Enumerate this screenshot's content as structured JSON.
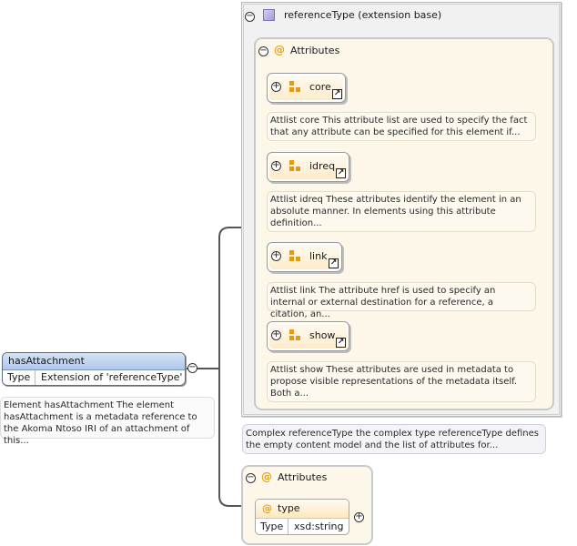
{
  "reference_type": {
    "title": "referenceType (extension base)",
    "attributes_label": "Attributes",
    "attlists": [
      {
        "name": "core",
        "description": "Attlist core This attribute list are used to specify the fact that any attribute can be specified for this element if..."
      },
      {
        "name": "idreq",
        "description": "Attlist idreq These attributes identify the element in an absolute manner. In elements using this attribute definition..."
      },
      {
        "name": "link",
        "description": "Attlist link The attribute href is used to specify an internal or external destination for a reference, a citation, an..."
      },
      {
        "name": "show",
        "description": "Attlist show These attributes are used in metadata to propose visible representations of the metadata itself. Both a..."
      }
    ],
    "description": "Complex referenceType the complex type referenceType defines the empty content model and the list of attributes for..."
  },
  "element": {
    "name": "hasAttachment",
    "type_key": "Type",
    "type_value": "Extension of 'referenceType'",
    "description": "Element hasAttachment The element hasAttachment is a metadata reference to the Akoma Ntoso IRI of an attachment of this..."
  },
  "local_attributes": {
    "label": "Attributes",
    "attribute": {
      "name": "type",
      "type_key": "Type",
      "type_value": "xsd:string"
    }
  },
  "symbols": {
    "collapse": "−",
    "expand": "+",
    "attribute": "@",
    "link_arrow": "↗"
  },
  "colors": {
    "attr_icon": "#e49b12",
    "element_header": "#aec7ea",
    "type_icon": "#a99ad8"
  }
}
